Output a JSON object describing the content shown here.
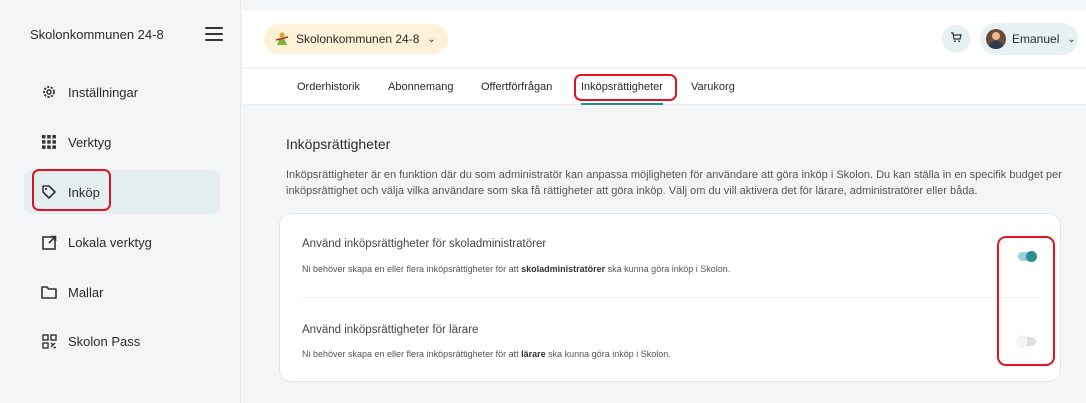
{
  "sidebar": {
    "title": "Skolonkommunen 24-8",
    "menu_icon": "hamburger-icon",
    "items": [
      {
        "label": "Inställningar",
        "icon": "gear-icon"
      },
      {
        "label": "Verktyg",
        "icon": "grid-icon"
      },
      {
        "label": "Inköp",
        "icon": "tag-icon",
        "active": true
      },
      {
        "label": "Lokala verktyg",
        "icon": "external-link-icon"
      },
      {
        "label": "Mallar",
        "icon": "folder-icon"
      },
      {
        "label": "Skolon Pass",
        "icon": "qr-code-icon"
      }
    ]
  },
  "topbar": {
    "org_name": "Skolonkommunen 24-8",
    "org_icon": "skolon-logo-icon",
    "cart_icon": "cart-icon",
    "user_name": "Emanuel"
  },
  "tabs": [
    {
      "label": "Orderhistorik"
    },
    {
      "label": "Abonnemang"
    },
    {
      "label": "Offertförfrågan"
    },
    {
      "label": "Inköpsrättigheter",
      "active": true
    },
    {
      "label": "Varukorg"
    }
  ],
  "main": {
    "title": "Inköpsrättigheter",
    "description": "Inköpsrättigheter är en funktion där du som administratör kan anpassa möjligheten för användare att göra inköp i Skolon. Du kan ställa in en specifik budget per inköpsrättighet och välja vilka användare som ska få rättigheter att göra inköp. Välj om du vill aktivera det för lärare, administratörer eller båda.",
    "settings": [
      {
        "title": "Använd inköpsrättigheter för skoladministratörer",
        "sub_before": "Ni behöver skapa en eller flera inköpsrättigheter för att ",
        "sub_bold": "skoladministratörer",
        "sub_after": " ska kunna göra inköp i Skolon.",
        "enabled": true
      },
      {
        "title": "Använd inköpsrättigheter för lärare",
        "sub_before": "Ni behöver skapa en eller flera inköpsrättigheter för att ",
        "sub_bold": "lärare",
        "sub_after": " ska kunna göra inköp i Skolon.",
        "enabled": false
      }
    ]
  },
  "colors": {
    "accent": "#2a8e95",
    "highlight": "#e0141e",
    "org_pill": "#fdf1d8"
  }
}
